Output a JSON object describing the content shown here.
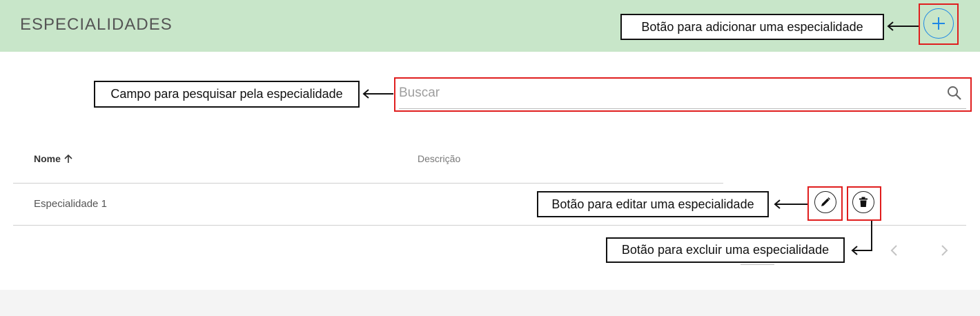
{
  "header": {
    "title": "ESPECIALIDADES",
    "add_button_icon": "plus-icon"
  },
  "search": {
    "placeholder": "Buscar",
    "value": "",
    "icon": "search-icon"
  },
  "table": {
    "columns": [
      {
        "label": "Nome",
        "sort": "ascending"
      },
      {
        "label": "Descrição"
      }
    ],
    "rows": [
      {
        "nome": "Especialidade 1",
        "descricao": ""
      }
    ],
    "row_actions": [
      "edit-icon",
      "trash-icon"
    ]
  },
  "pagination": {
    "prev_icon": "chevron-left-icon",
    "next_icon": "chevron-right-icon"
  },
  "annotations": {
    "add": "Botão para adicionar uma especialidade",
    "search": "Campo para pesquisar pela especialidade",
    "edit": "Botão para editar uma especialidade",
    "delete": "Botão para excluir uma especialidade"
  },
  "colors": {
    "header_bg": "#c8e6c9",
    "accent": "#1e88e5",
    "annotation_highlight": "#e01e1e"
  }
}
